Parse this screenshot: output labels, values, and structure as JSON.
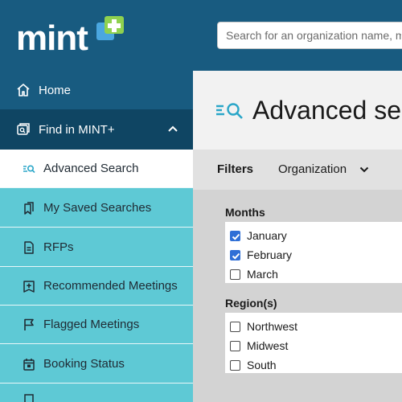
{
  "app": {
    "logo_text": "mint"
  },
  "search": {
    "placeholder": "Search for an organization name, m"
  },
  "sidebar": {
    "home_label": "Home",
    "find_label": "Find in MINT+",
    "items": [
      {
        "label": "Advanced Search",
        "icon": "advanced-search-icon",
        "active": true
      },
      {
        "label": "My Saved Searches",
        "icon": "saved-searches-icon"
      },
      {
        "label": "RFPs",
        "icon": "document-icon"
      },
      {
        "label": "Recommended Meetings",
        "icon": "recommended-icon"
      },
      {
        "label": "Flagged Meetings",
        "icon": "flag-icon"
      },
      {
        "label": "Booking Status",
        "icon": "calendar-icon"
      }
    ]
  },
  "main": {
    "title": "Advanced sea",
    "filters": {
      "label": "Filters",
      "organization_label": "Organization"
    },
    "groups": [
      {
        "label": "Months",
        "options": [
          {
            "label": "January",
            "checked": true
          },
          {
            "label": "February",
            "checked": true
          },
          {
            "label": "March",
            "checked": false
          }
        ]
      },
      {
        "label": "Region(s)",
        "options": [
          {
            "label": "Northwest",
            "checked": false
          },
          {
            "label": "Midwest",
            "checked": false
          },
          {
            "label": "South",
            "checked": false
          }
        ]
      }
    ]
  },
  "colors": {
    "topbar": "#185b80",
    "sidebar_accent": "#5ec9d5",
    "logo_mark_blue": "#4aa7e0",
    "logo_mark_green": "#8fd14f",
    "checkbox_checked": "#2f6fd6"
  }
}
